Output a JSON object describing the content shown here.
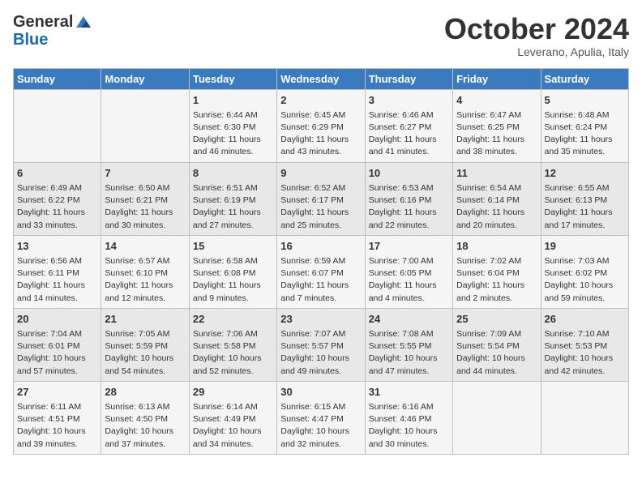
{
  "header": {
    "logo_line1": "General",
    "logo_line2": "Blue",
    "month": "October 2024",
    "location": "Leverano, Apulia, Italy"
  },
  "weekdays": [
    "Sunday",
    "Monday",
    "Tuesday",
    "Wednesday",
    "Thursday",
    "Friday",
    "Saturday"
  ],
  "weeks": [
    [
      {
        "day": "",
        "info": ""
      },
      {
        "day": "",
        "info": ""
      },
      {
        "day": "1",
        "info": "Sunrise: 6:44 AM\nSunset: 6:30 PM\nDaylight: 11 hours and 46 minutes."
      },
      {
        "day": "2",
        "info": "Sunrise: 6:45 AM\nSunset: 6:29 PM\nDaylight: 11 hours and 43 minutes."
      },
      {
        "day": "3",
        "info": "Sunrise: 6:46 AM\nSunset: 6:27 PM\nDaylight: 11 hours and 41 minutes."
      },
      {
        "day": "4",
        "info": "Sunrise: 6:47 AM\nSunset: 6:25 PM\nDaylight: 11 hours and 38 minutes."
      },
      {
        "day": "5",
        "info": "Sunrise: 6:48 AM\nSunset: 6:24 PM\nDaylight: 11 hours and 35 minutes."
      }
    ],
    [
      {
        "day": "6",
        "info": "Sunrise: 6:49 AM\nSunset: 6:22 PM\nDaylight: 11 hours and 33 minutes."
      },
      {
        "day": "7",
        "info": "Sunrise: 6:50 AM\nSunset: 6:21 PM\nDaylight: 11 hours and 30 minutes."
      },
      {
        "day": "8",
        "info": "Sunrise: 6:51 AM\nSunset: 6:19 PM\nDaylight: 11 hours and 27 minutes."
      },
      {
        "day": "9",
        "info": "Sunrise: 6:52 AM\nSunset: 6:17 PM\nDaylight: 11 hours and 25 minutes."
      },
      {
        "day": "10",
        "info": "Sunrise: 6:53 AM\nSunset: 6:16 PM\nDaylight: 11 hours and 22 minutes."
      },
      {
        "day": "11",
        "info": "Sunrise: 6:54 AM\nSunset: 6:14 PM\nDaylight: 11 hours and 20 minutes."
      },
      {
        "day": "12",
        "info": "Sunrise: 6:55 AM\nSunset: 6:13 PM\nDaylight: 11 hours and 17 minutes."
      }
    ],
    [
      {
        "day": "13",
        "info": "Sunrise: 6:56 AM\nSunset: 6:11 PM\nDaylight: 11 hours and 14 minutes."
      },
      {
        "day": "14",
        "info": "Sunrise: 6:57 AM\nSunset: 6:10 PM\nDaylight: 11 hours and 12 minutes."
      },
      {
        "day": "15",
        "info": "Sunrise: 6:58 AM\nSunset: 6:08 PM\nDaylight: 11 hours and 9 minutes."
      },
      {
        "day": "16",
        "info": "Sunrise: 6:59 AM\nSunset: 6:07 PM\nDaylight: 11 hours and 7 minutes."
      },
      {
        "day": "17",
        "info": "Sunrise: 7:00 AM\nSunset: 6:05 PM\nDaylight: 11 hours and 4 minutes."
      },
      {
        "day": "18",
        "info": "Sunrise: 7:02 AM\nSunset: 6:04 PM\nDaylight: 11 hours and 2 minutes."
      },
      {
        "day": "19",
        "info": "Sunrise: 7:03 AM\nSunset: 6:02 PM\nDaylight: 10 hours and 59 minutes."
      }
    ],
    [
      {
        "day": "20",
        "info": "Sunrise: 7:04 AM\nSunset: 6:01 PM\nDaylight: 10 hours and 57 minutes."
      },
      {
        "day": "21",
        "info": "Sunrise: 7:05 AM\nSunset: 5:59 PM\nDaylight: 10 hours and 54 minutes."
      },
      {
        "day": "22",
        "info": "Sunrise: 7:06 AM\nSunset: 5:58 PM\nDaylight: 10 hours and 52 minutes."
      },
      {
        "day": "23",
        "info": "Sunrise: 7:07 AM\nSunset: 5:57 PM\nDaylight: 10 hours and 49 minutes."
      },
      {
        "day": "24",
        "info": "Sunrise: 7:08 AM\nSunset: 5:55 PM\nDaylight: 10 hours and 47 minutes."
      },
      {
        "day": "25",
        "info": "Sunrise: 7:09 AM\nSunset: 5:54 PM\nDaylight: 10 hours and 44 minutes."
      },
      {
        "day": "26",
        "info": "Sunrise: 7:10 AM\nSunset: 5:53 PM\nDaylight: 10 hours and 42 minutes."
      }
    ],
    [
      {
        "day": "27",
        "info": "Sunrise: 6:11 AM\nSunset: 4:51 PM\nDaylight: 10 hours and 39 minutes."
      },
      {
        "day": "28",
        "info": "Sunrise: 6:13 AM\nSunset: 4:50 PM\nDaylight: 10 hours and 37 minutes."
      },
      {
        "day": "29",
        "info": "Sunrise: 6:14 AM\nSunset: 4:49 PM\nDaylight: 10 hours and 34 minutes."
      },
      {
        "day": "30",
        "info": "Sunrise: 6:15 AM\nSunset: 4:47 PM\nDaylight: 10 hours and 32 minutes."
      },
      {
        "day": "31",
        "info": "Sunrise: 6:16 AM\nSunset: 4:46 PM\nDaylight: 10 hours and 30 minutes."
      },
      {
        "day": "",
        "info": ""
      },
      {
        "day": "",
        "info": ""
      }
    ]
  ]
}
